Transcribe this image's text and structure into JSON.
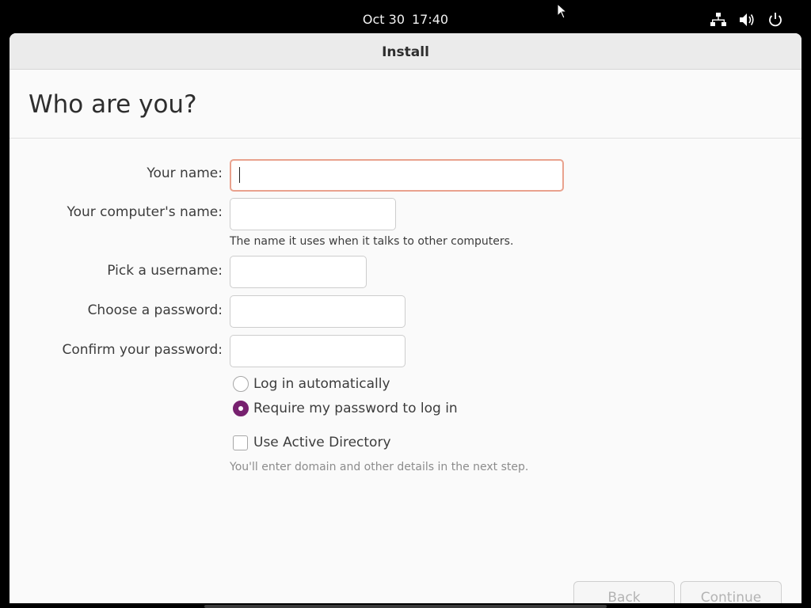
{
  "topbar": {
    "date": "Oct 30",
    "time": "17:40",
    "icons": [
      "network-icon",
      "volume-icon",
      "power-icon"
    ]
  },
  "window": {
    "title": "Install"
  },
  "page": {
    "title": "Who are you?"
  },
  "form": {
    "name_label": "Your name:",
    "name_value": "",
    "computer_label": "Your computer's name:",
    "computer_value": "",
    "computer_hint": "The name it uses when it talks to other computers.",
    "username_label": "Pick a username:",
    "username_value": "",
    "password_label": "Choose a password:",
    "password_value": "",
    "confirm_label": "Confirm your password:",
    "confirm_value": ""
  },
  "login_options": {
    "auto_label": "Log in automatically",
    "require_label": "Require my password to log in",
    "selected": "require"
  },
  "active_directory": {
    "label": "Use Active Directory",
    "checked": false,
    "hint": "You'll enter domain and other details in the next step."
  },
  "buttons": {
    "back": "Back",
    "continue": "Continue"
  },
  "colors": {
    "accent": "#77216f",
    "focus_border": "#e9a28e",
    "topbar": "#000000",
    "window_bg": "#fafafa"
  }
}
